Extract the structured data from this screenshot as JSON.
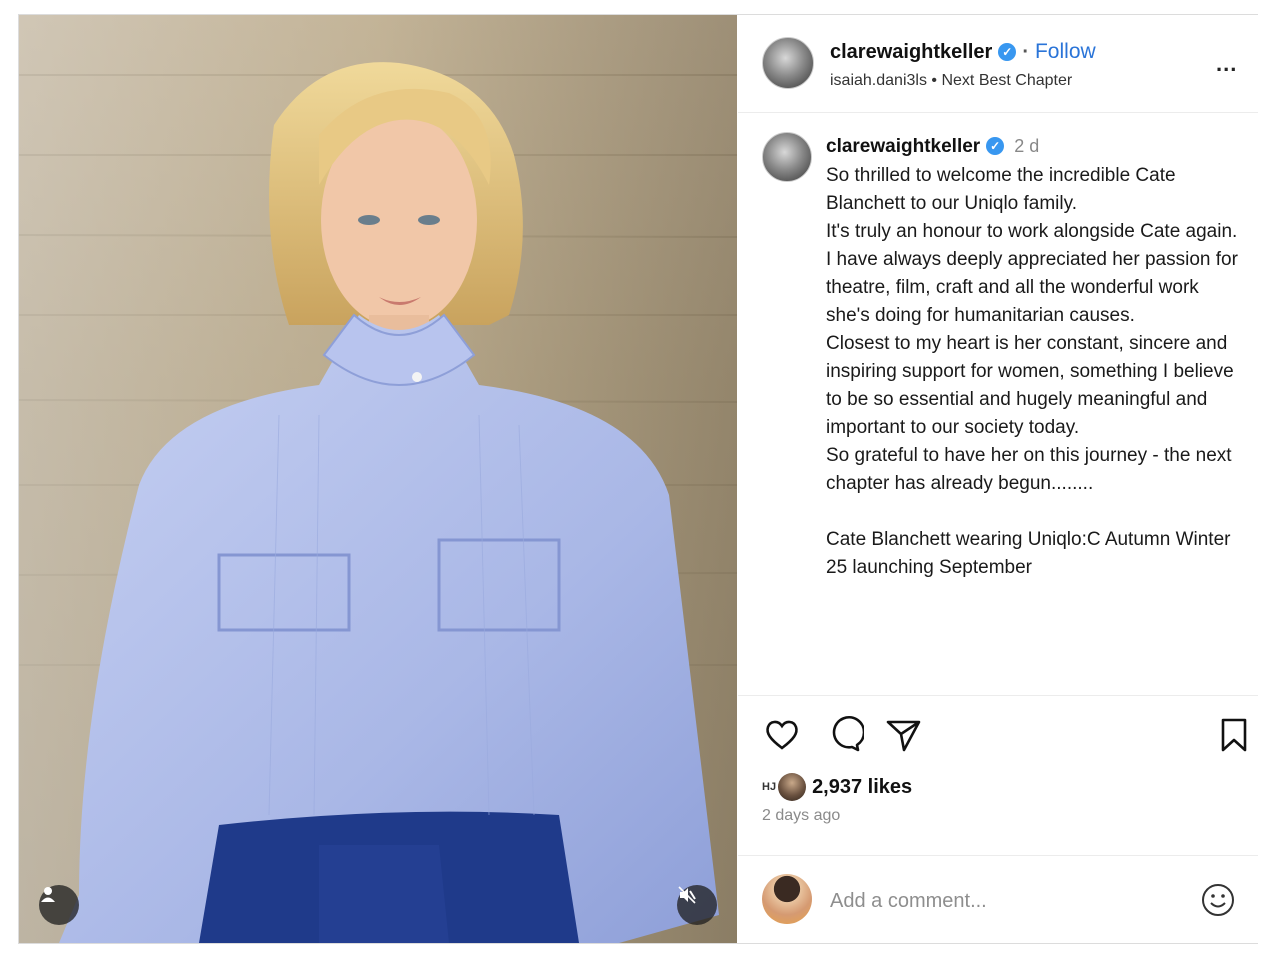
{
  "post": {
    "username": "clarewaightkeller",
    "follow_label": "Follow",
    "collaborator": "isaiah.dani3ls",
    "music_sep": "•",
    "audio_title": "Next Best Chapter",
    "more_label": "...",
    "time_short": "2 d"
  },
  "caption": {
    "paragraphs": [
      "So thrilled to welcome the incredible Cate Blanchett to our Uniqlo family.",
      "It's truly an honour to work alongside Cate again.",
      "I have always deeply appreciated her passion for theatre, film, craft and all the wonderful work she's doing for humanitarian causes.",
      "Closest to my heart is her constant, sincere and inspiring support for women, something I believe to be so essential and hugely meaningful and important to our society today.",
      "So grateful to have her on this journey - the next chapter has already begun........",
      "",
      "Cate Blanchett wearing Uniqlo:C Autumn Winter 25 launching September"
    ]
  },
  "engagement": {
    "liker_initials": "HJ",
    "likes": "2,937 likes",
    "posted_ago": "2 days ago"
  },
  "comment": {
    "placeholder": "Add a comment..."
  },
  "colors": {
    "follow": "#2a74d8",
    "verified": "#3897f0",
    "shirt": "#aab8e6",
    "trousers": "#1f3a8a"
  },
  "icons": {
    "like": "heart-icon",
    "comment": "comment-bubble-icon",
    "share": "paper-plane-icon",
    "save": "bookmark-icon",
    "tag": "user-tag-icon",
    "mute": "speaker-muted-icon",
    "emoji": "smiley-icon"
  }
}
